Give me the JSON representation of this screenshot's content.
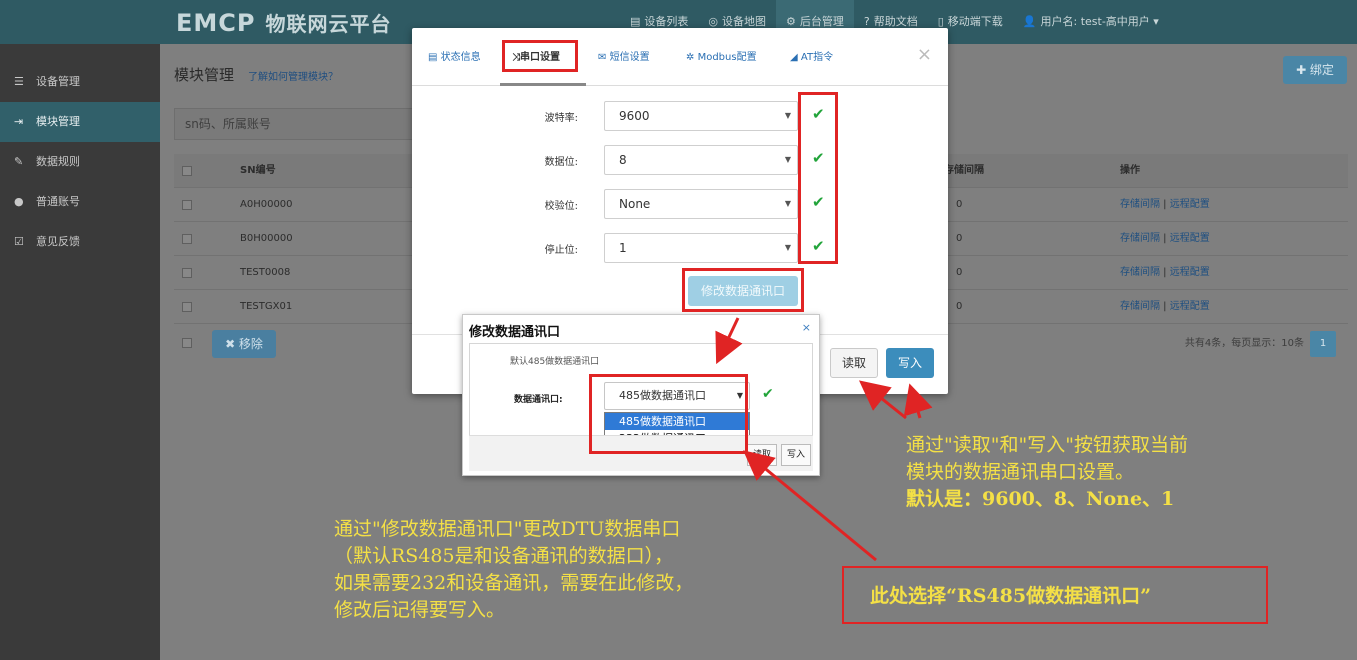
{
  "brand": {
    "logo": "EMCP",
    "name": "物联网云平台"
  },
  "nav": [
    {
      "icon": "list-icon",
      "glyph": "▤",
      "label": "设备列表"
    },
    {
      "icon": "map-icon",
      "glyph": "◎",
      "label": "设备地图"
    },
    {
      "icon": "gear-icon",
      "glyph": "⚙",
      "label": "后台管理"
    },
    {
      "icon": "help-icon",
      "glyph": "?",
      "label": "帮助文档"
    },
    {
      "icon": "mobile-icon",
      "glyph": "▯",
      "label": "移动端下载"
    },
    {
      "icon": "user-icon",
      "glyph": "👤",
      "label": "用户名: test-高中用户 ▾"
    }
  ],
  "sidebar": [
    {
      "icon": "grid-list-icon",
      "glyph": "☰",
      "label": "设备管理"
    },
    {
      "icon": "login-icon",
      "glyph": "⇥",
      "label": "模块管理"
    },
    {
      "icon": "pencil-icon",
      "glyph": "✎",
      "label": "数据规则"
    },
    {
      "icon": "person-icon",
      "glyph": "●",
      "label": "普通账号"
    },
    {
      "icon": "edit-icon",
      "glyph": "☑",
      "label": "意见反馈"
    }
  ],
  "page": {
    "title": "模块管理",
    "help_link": "了解如何管理模块？",
    "bind_button": "✚ 绑定",
    "search_placeholder": "sn码、所属账号",
    "table": {
      "headers": [
        "SN编号",
        "存储间隔",
        "操作"
      ],
      "rows": [
        {
          "sn": "A0H00000",
          "interval": "0",
          "actions": [
            "存储间隔",
            "远程配置"
          ]
        },
        {
          "sn": "B0H00000",
          "interval": "0",
          "actions": [
            "存储间隔",
            "远程配置"
          ]
        },
        {
          "sn": "TEST0008",
          "interval": "0",
          "actions": [
            "存储间隔",
            "远程配置"
          ]
        },
        {
          "sn": "TESTGX01",
          "interval": "0",
          "actions": [
            "存储间隔",
            "远程配置"
          ]
        }
      ]
    },
    "remove_button": "✖ 移除",
    "pager_text": "共有4条，每页显示：10条",
    "pager_page": "1"
  },
  "modal": {
    "tabs": [
      {
        "icon": "info-icon",
        "glyph": "▤",
        "label": "状态信息"
      },
      {
        "icon": "shuffle-icon",
        "glyph": "⤨",
        "label": "串口设置"
      },
      {
        "icon": "envelope-icon",
        "glyph": "✉",
        "label": "短信设置"
      },
      {
        "icon": "cog-icon",
        "glyph": "✲",
        "label": "Modbus配置"
      },
      {
        "icon": "send-icon",
        "glyph": "◢",
        "label": "AT指令"
      }
    ],
    "close": "×",
    "fields": [
      {
        "label": "波特率:",
        "value": "9600"
      },
      {
        "label": "数据位:",
        "value": "8"
      },
      {
        "label": "校验位:",
        "value": "None"
      },
      {
        "label": "停止位:",
        "value": "1"
      }
    ],
    "modify_button": "修改数据通讯口",
    "read_button": "读取",
    "write_button": "写入"
  },
  "popup": {
    "title": "修改数据通讯口",
    "close": "×",
    "note": "默认485做数据通讯口",
    "label": "数据通讯口:",
    "selected": "485做数据通讯口",
    "options": [
      "485做数据通讯口",
      "232做数据通讯口"
    ],
    "read_button": "读取",
    "write_button": "写入"
  },
  "annotations": {
    "right_lines": [
      "通过\"读取\"和\"写入\"按钮获取当前",
      "模块的数据通讯串口设置。",
      "默认是：9600、8、None、1"
    ],
    "left_lines": [
      "通过\"修改数据通讯口\"更改DTU数据串口",
      "（默认RS485是和设备通讯的数据口），",
      "如果需要232和设备通讯，需要在此修改，",
      "修改后记得要写入。"
    ],
    "callout": "此处选择“RS485做数据通讯口”"
  },
  "colors": {
    "highlight": "#e02424",
    "annotation": "#f4e046",
    "primary": "#3c8dbc",
    "check": "#22a43a"
  }
}
